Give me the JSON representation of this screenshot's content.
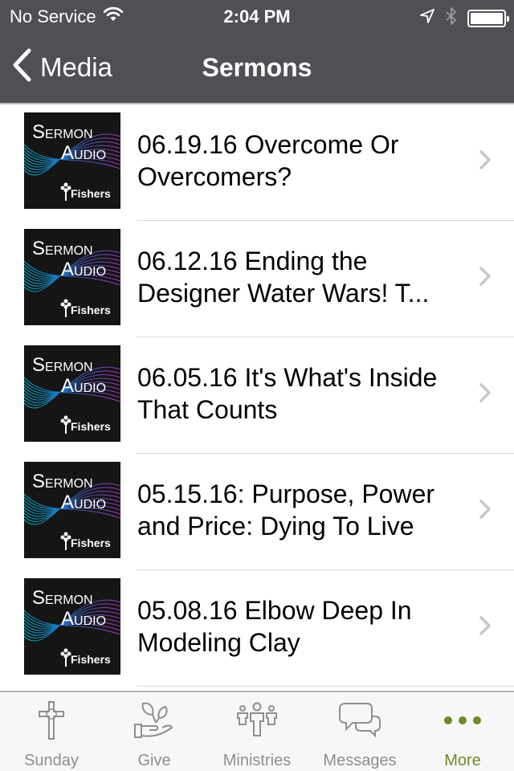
{
  "status_bar": {
    "carrier": "No Service",
    "time": "2:04 PM",
    "icons": [
      "wifi-icon",
      "location-arrow-icon",
      "bluetooth-icon",
      "battery-icon"
    ],
    "battery_level": 1.0
  },
  "nav_bar": {
    "back_label": "Media",
    "title": "Sermons"
  },
  "thumbnail": {
    "line1": "Sermon",
    "line2": "Audio",
    "brand": "Fishers"
  },
  "sermons": [
    {
      "title": "06.19.16 Overcome Or Overcomers?"
    },
    {
      "title": "06.12.16 Ending the Designer Water Wars! T..."
    },
    {
      "title": "06.05.16  It's What's Inside That Counts"
    },
    {
      "title": "05.15.16: Purpose, Power and Price: Dying To Live"
    },
    {
      "title": "05.08.16 Elbow Deep In Modeling Clay"
    }
  ],
  "tabs": [
    {
      "label": "Sunday",
      "icon": "cross-icon",
      "active": false
    },
    {
      "label": "Give",
      "icon": "hand-plant-icon",
      "active": false
    },
    {
      "label": "Ministries",
      "icon": "people-icon",
      "active": false
    },
    {
      "label": "Messages",
      "icon": "chat-bubbles-icon",
      "active": false
    },
    {
      "label": "More",
      "icon": "more-dots-icon",
      "active": true
    }
  ],
  "colors": {
    "nav_background": "#4f5055",
    "accent": "#6f8a2a",
    "tab_inactive": "#8e8e93",
    "chevron": "#c7c7cc"
  }
}
